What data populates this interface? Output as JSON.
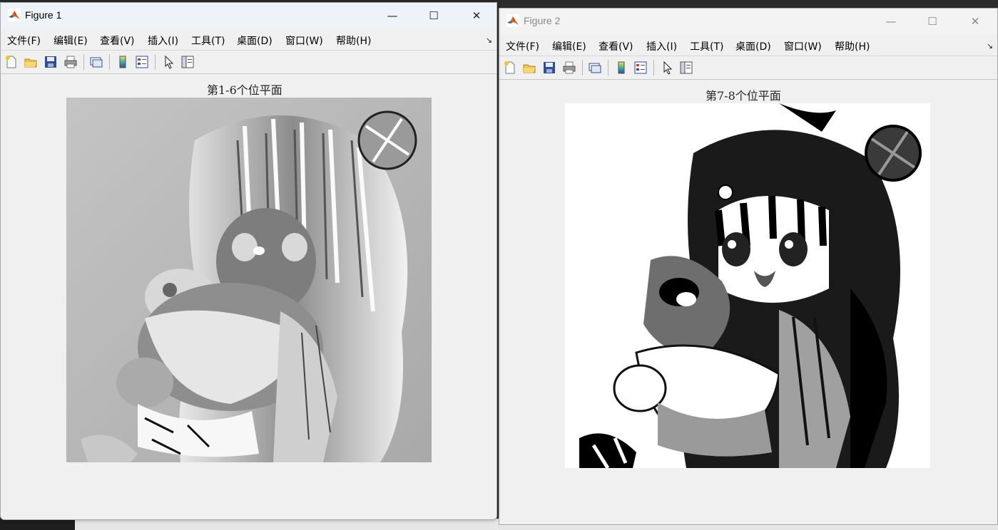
{
  "figure1": {
    "title": "Figure 1",
    "controls": {
      "minimize": "—",
      "maximize": "☐",
      "close": "✕"
    },
    "menu": [
      "文件(F)",
      "编辑(E)",
      "查看(V)",
      "插入(I)",
      "工具(T)",
      "桌面(D)",
      "窗口(W)",
      "帮助(H)"
    ],
    "axes_title": "第1-6个位平面"
  },
  "figure2": {
    "title": "Figure 2",
    "controls": {
      "minimize": "—",
      "maximize": "☐",
      "close": "✕"
    },
    "menu": [
      "文件(F)",
      "编辑(E)",
      "查看(V)",
      "插入(I)",
      "工具(T)",
      "桌面(D)",
      "窗口(W)",
      "帮助(H)"
    ],
    "axes_title": "第7-8个位平面"
  },
  "toolbar_icons": [
    "new-figure-icon",
    "open-file-icon",
    "save-icon",
    "print-icon",
    "link-plot-icon",
    "colorbar-icon",
    "legend-icon",
    "edit-plot-arrow-icon",
    "property-inspector-icon"
  ],
  "dock_arrow": "↘",
  "colors": {
    "window_bg": "#f0f0f0",
    "active_title_bg": "#eef2f9",
    "matlab_orange": "#e2661e"
  }
}
